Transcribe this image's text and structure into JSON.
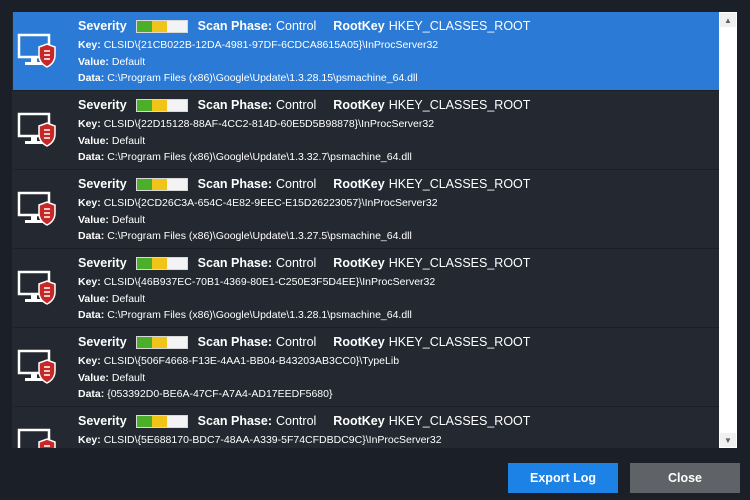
{
  "labels": {
    "severity": "Severity",
    "scan_phase": "Scan Phase:",
    "root_key": "RootKey",
    "key": "Key:",
    "value": "Value:",
    "data": "Data:"
  },
  "colors": {
    "selected_row": "#2a7ad6",
    "row_bg": "#232831",
    "export_button": "#1c82e6",
    "close_button": "#5f6266",
    "severity_low": "#4caf2a",
    "severity_mid": "#f0c419"
  },
  "severity_level": 0.6,
  "items": [
    {
      "scan_phase": "Control",
      "root_key": "HKEY_CLASSES_ROOT",
      "key": "CLSID\\{21CB022B-12DA-4981-97DF-6CDCA8615A05}\\InProcServer32",
      "value": "Default",
      "data": "C:\\Program Files (x86)\\Google\\Update\\1.3.28.15\\psmachine_64.dll",
      "selected": true
    },
    {
      "scan_phase": "Control",
      "root_key": "HKEY_CLASSES_ROOT",
      "key": "CLSID\\{22D15128-88AF-4CC2-814D-60E5D5B98878}\\InProcServer32",
      "value": "Default",
      "data": "C:\\Program Files (x86)\\Google\\Update\\1.3.32.7\\psmachine_64.dll"
    },
    {
      "scan_phase": "Control",
      "root_key": "HKEY_CLASSES_ROOT",
      "key": "CLSID\\{2CD26C3A-654C-4E82-9EEC-E15D26223057}\\InProcServer32",
      "value": "Default",
      "data": "C:\\Program Files (x86)\\Google\\Update\\1.3.27.5\\psmachine_64.dll"
    },
    {
      "scan_phase": "Control",
      "root_key": "HKEY_CLASSES_ROOT",
      "key": "CLSID\\{46B937EC-70B1-4369-80E1-C250E3F5D4EE}\\InProcServer32",
      "value": "Default",
      "data": "C:\\Program Files (x86)\\Google\\Update\\1.3.28.1\\psmachine_64.dll"
    },
    {
      "scan_phase": "Control",
      "root_key": "HKEY_CLASSES_ROOT",
      "key": "CLSID\\{506F4668-F13E-4AA1-BB04-B43203AB3CC0}\\TypeLib",
      "value": "Default",
      "data": "{053392D0-BE6A-47CF-A7A4-AD17EEDF5680}"
    },
    {
      "scan_phase": "Control",
      "root_key": "HKEY_CLASSES_ROOT",
      "key": "CLSID\\{5E688170-BDC7-48AA-A339-5F74CFDBDC9C}\\InProcServer32",
      "value": "",
      "data": ""
    }
  ],
  "buttons": {
    "export_log": "Export Log",
    "close": "Close"
  },
  "icons": {
    "row_icon": "monitor-with-shield-icon",
    "scroll_up": "scroll-up-arrow-icon",
    "scroll_down": "scroll-down-arrow-icon"
  }
}
